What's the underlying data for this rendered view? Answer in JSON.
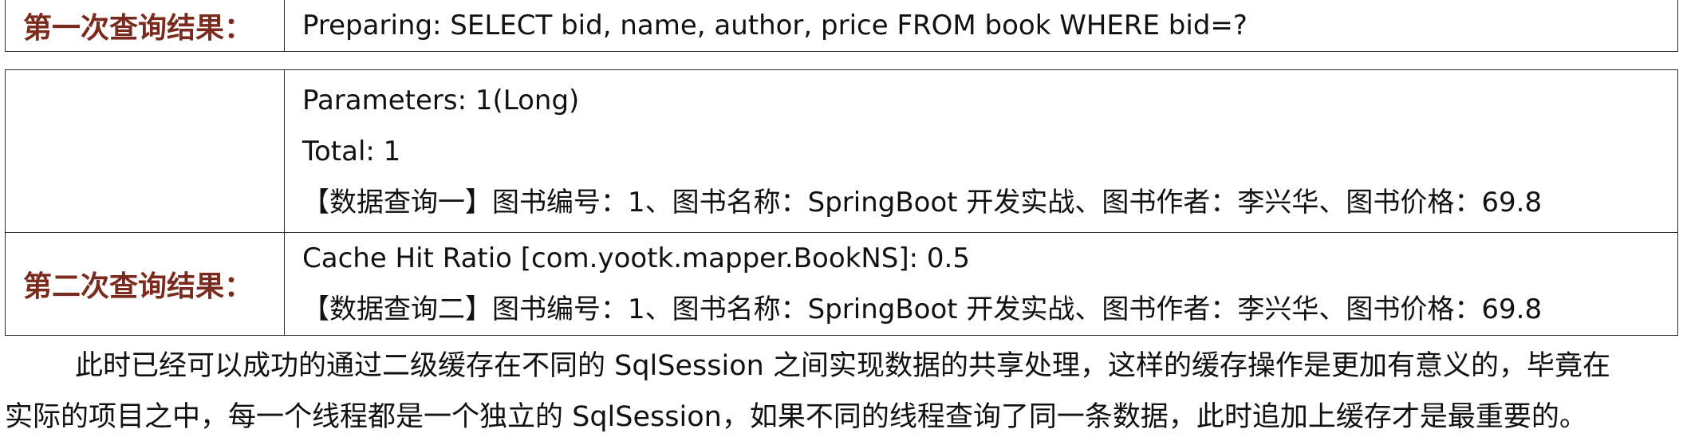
{
  "first_result": {
    "label": "第一次查询结果：",
    "lines": [
      "Preparing: SELECT bid, name, author, price FROM book WHERE bid=?"
    ]
  },
  "first_result_cont": {
    "label": "",
    "lines": [
      "Parameters: 1(Long)",
      "Total: 1",
      "【数据查询一】图书编号：1、图书名称：SpringBoot 开发实战、图书作者：李兴华、图书价格：69.8"
    ]
  },
  "second_result": {
    "label": "第二次查询结果：",
    "lines": [
      "Cache Hit Ratio [com.yootk.mapper.BookNS]: 0.5",
      "【数据查询二】图书编号：1、图书名称：SpringBoot 开发实战、图书作者：李兴华、图书价格：69.8"
    ]
  },
  "paragraph": {
    "line1": "此时已经可以成功的通过二级缓存在不同的 SqlSession 之间实现数据的共享处理，这样的缓存操作是更加有意义的，毕竟在",
    "line2": "实际的项目之中，每一个线程都是一个独立的 SqlSession，如果不同的线程查询了同一条数据，此时追加上缓存才是最重要的。"
  },
  "colors": {
    "label_text": "#7a2b1e",
    "border": "#2a2a2a"
  }
}
